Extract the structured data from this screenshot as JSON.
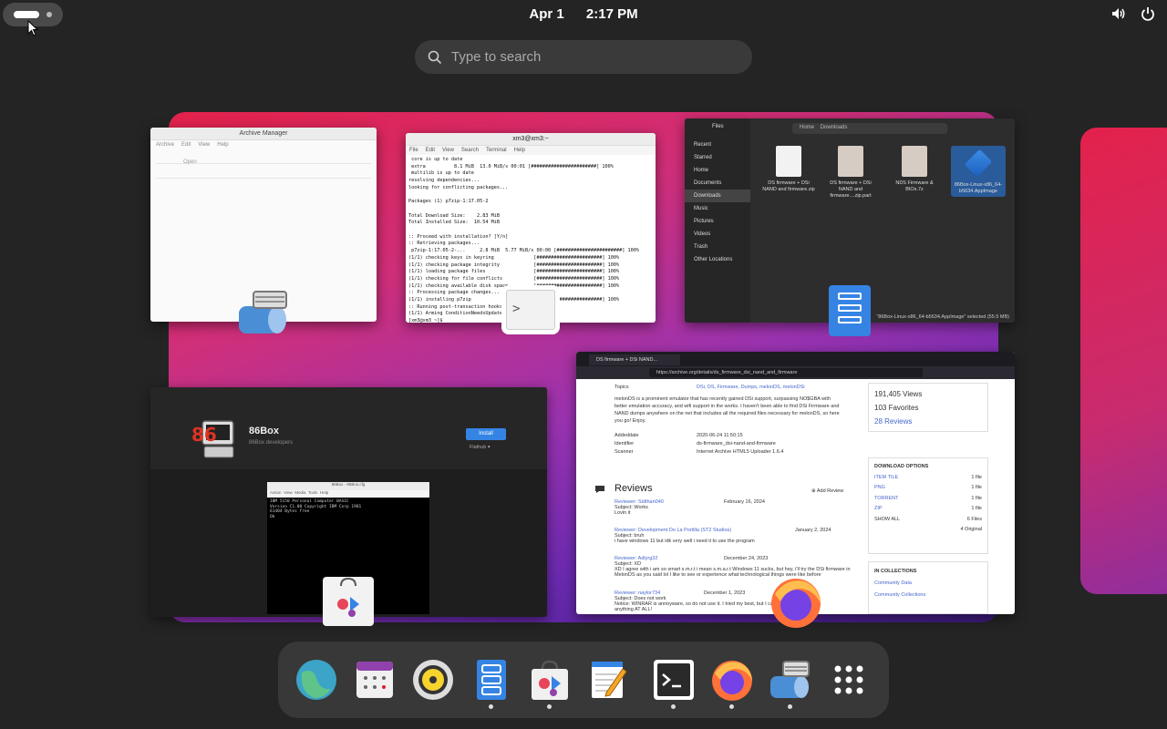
{
  "topbar": {
    "date": "Apr 1",
    "time": "2:17 PM"
  },
  "search": {
    "placeholder": "Type to search"
  },
  "archive": {
    "title": "Archive Manager",
    "menu": [
      "Archive",
      "Edit",
      "View",
      "Help"
    ],
    "open_label": "Open"
  },
  "terminal": {
    "title": "xm3@xm3:~",
    "menu": [
      "File",
      "Edit",
      "View",
      "Search",
      "Terminal",
      "Help"
    ],
    "lines": [
      " core is up to date",
      " extra          8.1 MiB  13.0 MiB/s 00:01 [#######################] 100%",
      " multilib is up to date",
      "resolving dependencies...",
      "looking for conflicting packages...",
      "",
      "Packages (1) p7zip-1:17.05-2",
      "",
      "Total Download Size:    2.83 MiB",
      "Total Installed Size:  10.54 MiB",
      "",
      ":: Proceed with installation? [Y/n]",
      ":: Retrieving packages...",
      " p7zip-1:17.05-2-...     2.8 MiB  5.77 MiB/s 00:00 [#######################] 100%",
      "(1/1) checking keys in keyring              [#######################] 100%",
      "(1/1) checking package integrity            [#######################] 100%",
      "(1/1) loading package files                 [#######################] 100%",
      "(1/1) checking for file conflicts           [#######################] 100%",
      "(1/1) checking available disk space         [#######################] 100%",
      ":: Processing package changes...",
      "(1/1) installing p7zip                      [#######################] 100%",
      ":: Running post-transaction hooks...",
      "(1/1) Arming ConditionNeedsUpdate...",
      "[xm3@xm3 ~]$ "
    ]
  },
  "files": {
    "title": "Files",
    "path_home": "Home",
    "path_current": "Downloads",
    "sidebar": [
      "Recent",
      "Starred",
      "Home",
      "Documents",
      "Downloads",
      "Music",
      "Pictures",
      "Videos",
      "Trash",
      "Other Locations"
    ],
    "items": [
      {
        "name": "DS firmware + DSi NAND and firmware.zip"
      },
      {
        "name": "DS firmware + DSi NAND and firmware....zip.part"
      },
      {
        "name": "NDS Firmware & BIOs.7z"
      },
      {
        "name": "86Box-Linux-x86_64-b5634.AppImage"
      }
    ],
    "status": "“86Box-Linux-x86_64-b5634.AppImage” selected (55.5 MB)"
  },
  "software": {
    "app_name": "86Box",
    "developer": "86Box developers",
    "install_label": "Install",
    "source_label": "Flathub",
    "screenshot_title": "86Box - 86Box.cfg",
    "screenshot_menu": [
      "Action",
      "View",
      "Media",
      "Tools",
      "Help"
    ],
    "screenshot_text": [
      "IBM 5150 Personal Computer BASIC",
      "Version C1.00 Copyright IBM Corp 1981",
      "61404 Bytes free",
      "Ok"
    ]
  },
  "firefox": {
    "tab_title": "DS firmware + DSi NAND...",
    "url": "https://archive.org/details/ds_firmware_dsi_nand_and_firmware",
    "topics_label": "Topics",
    "topics_value": "DSi, DS, Firmware, Dumps, melonDS, melonDSi",
    "description": "melonDS is a prominent emulator that has recently gained DSi support, surpassing NO$GBA with better emulation accuracy, and wifi support in the works. I haven't been able to find DSi Firmware and NAND dumps anywhere on the net that includes all the required files necessary for melonDS, so here you go! Enjoy.",
    "addeddate_label": "Addeddate",
    "addeddate_value": "2020-06-24 11:50:15",
    "identifier_label": "Identifier",
    "identifier_value": "ds-firmware_dsi-nand-and-firmware",
    "scanner_label": "Scanner",
    "scanner_value": "Internet Archive HTML5 Uploader 1.6.4",
    "views": "191,405 Views",
    "favorites": "103 Favorites",
    "reviews_count": "28 Reviews",
    "reviews_heading": "Reviews",
    "add_review": "Add Review",
    "reviews": [
      {
        "reviewer": "Reviewer: Sidthan040",
        "date": "February 16, 2024",
        "subject": "Subject: Works",
        "body": "Lovin it"
      },
      {
        "reviewer": "Reviewer: Development Do La Portilla (ST2 Studios)",
        "date": "January 2, 2024",
        "subject": "Subject: bruh",
        "body": "i have windows 11 but idk very well i need it to use the program"
      },
      {
        "reviewer": "Reviewer: Adlyrg32",
        "date": "December 24, 2023",
        "subject": "Subject: XD",
        "body": "XD I agree with i am so smart s.m.r.t i mean s.m.a.r.t Windows 11 sucks, but hey, i'll try the DSi firmware in MelonDS as you said lol I like to see or experience what technological things were like before"
      },
      {
        "reviewer": "Reviewer: naylor734",
        "date": "December 1, 2023",
        "subject": "Subject: Does not work",
        "body": "Notice: WINRAR is annoyware, so do not use it. I tried my best, but I cannot unzip anything AT ALL!"
      }
    ],
    "download_options_heading": "DOWNLOAD OPTIONS",
    "download_options": [
      {
        "label": "ITEM TILE",
        "count": "1 file"
      },
      {
        "label": "PNG",
        "count": "1 file"
      },
      {
        "label": "TORRENT",
        "count": "1 file"
      },
      {
        "label": "ZIP",
        "count": "1 file"
      }
    ],
    "show_all": "SHOW ALL",
    "files_count": "6 Files",
    "originals_count": "4 Original",
    "in_collections_heading": "IN COLLECTIONS",
    "collections": [
      "Community Data",
      "Community Collections"
    ]
  },
  "dock": {
    "items": [
      {
        "name": "Web Browser",
        "running": false
      },
      {
        "name": "Calendar",
        "running": false
      },
      {
        "name": "Rhythmbox",
        "running": false
      },
      {
        "name": "Files",
        "running": true
      },
      {
        "name": "Software",
        "running": true
      },
      {
        "name": "Text Editor",
        "running": false
      },
      {
        "name": "Terminal",
        "running": true
      },
      {
        "name": "Firefox",
        "running": true
      },
      {
        "name": "Archive Manager",
        "running": true
      },
      {
        "name": "Show Apps",
        "running": false
      }
    ]
  },
  "colors": {
    "accent": "#3584e4",
    "panel_bg": "#242424",
    "dock_bg": "#383838"
  }
}
